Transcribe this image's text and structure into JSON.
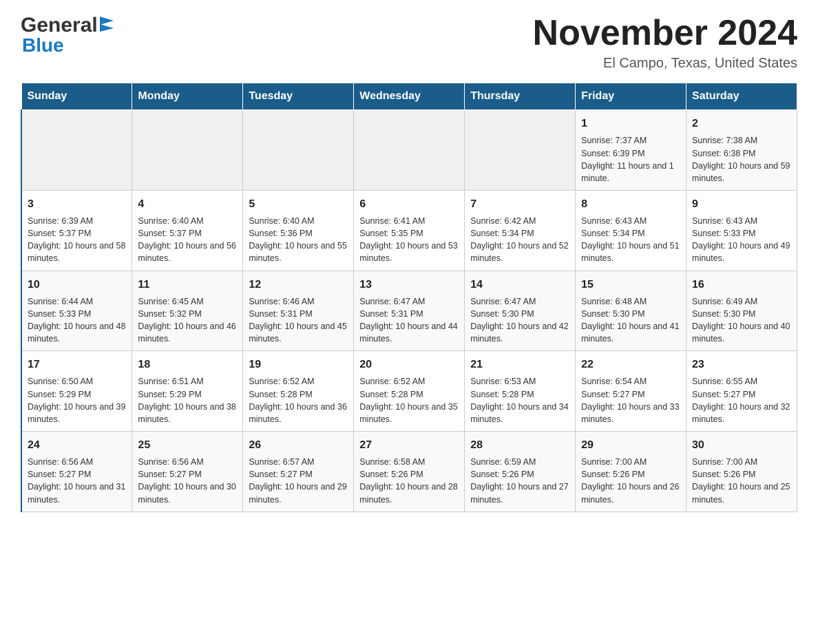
{
  "header": {
    "logo_general": "General",
    "logo_blue": "Blue",
    "month_title": "November 2024",
    "location": "El Campo, Texas, United States"
  },
  "days_of_week": [
    "Sunday",
    "Monday",
    "Tuesday",
    "Wednesday",
    "Thursday",
    "Friday",
    "Saturday"
  ],
  "weeks": [
    [
      {
        "num": "",
        "info": ""
      },
      {
        "num": "",
        "info": ""
      },
      {
        "num": "",
        "info": ""
      },
      {
        "num": "",
        "info": ""
      },
      {
        "num": "",
        "info": ""
      },
      {
        "num": "1",
        "info": "Sunrise: 7:37 AM\nSunset: 6:39 PM\nDaylight: 11 hours and 1 minute."
      },
      {
        "num": "2",
        "info": "Sunrise: 7:38 AM\nSunset: 6:38 PM\nDaylight: 10 hours and 59 minutes."
      }
    ],
    [
      {
        "num": "3",
        "info": "Sunrise: 6:39 AM\nSunset: 5:37 PM\nDaylight: 10 hours and 58 minutes."
      },
      {
        "num": "4",
        "info": "Sunrise: 6:40 AM\nSunset: 5:37 PM\nDaylight: 10 hours and 56 minutes."
      },
      {
        "num": "5",
        "info": "Sunrise: 6:40 AM\nSunset: 5:36 PM\nDaylight: 10 hours and 55 minutes."
      },
      {
        "num": "6",
        "info": "Sunrise: 6:41 AM\nSunset: 5:35 PM\nDaylight: 10 hours and 53 minutes."
      },
      {
        "num": "7",
        "info": "Sunrise: 6:42 AM\nSunset: 5:34 PM\nDaylight: 10 hours and 52 minutes."
      },
      {
        "num": "8",
        "info": "Sunrise: 6:43 AM\nSunset: 5:34 PM\nDaylight: 10 hours and 51 minutes."
      },
      {
        "num": "9",
        "info": "Sunrise: 6:43 AM\nSunset: 5:33 PM\nDaylight: 10 hours and 49 minutes."
      }
    ],
    [
      {
        "num": "10",
        "info": "Sunrise: 6:44 AM\nSunset: 5:33 PM\nDaylight: 10 hours and 48 minutes."
      },
      {
        "num": "11",
        "info": "Sunrise: 6:45 AM\nSunset: 5:32 PM\nDaylight: 10 hours and 46 minutes."
      },
      {
        "num": "12",
        "info": "Sunrise: 6:46 AM\nSunset: 5:31 PM\nDaylight: 10 hours and 45 minutes."
      },
      {
        "num": "13",
        "info": "Sunrise: 6:47 AM\nSunset: 5:31 PM\nDaylight: 10 hours and 44 minutes."
      },
      {
        "num": "14",
        "info": "Sunrise: 6:47 AM\nSunset: 5:30 PM\nDaylight: 10 hours and 42 minutes."
      },
      {
        "num": "15",
        "info": "Sunrise: 6:48 AM\nSunset: 5:30 PM\nDaylight: 10 hours and 41 minutes."
      },
      {
        "num": "16",
        "info": "Sunrise: 6:49 AM\nSunset: 5:30 PM\nDaylight: 10 hours and 40 minutes."
      }
    ],
    [
      {
        "num": "17",
        "info": "Sunrise: 6:50 AM\nSunset: 5:29 PM\nDaylight: 10 hours and 39 minutes."
      },
      {
        "num": "18",
        "info": "Sunrise: 6:51 AM\nSunset: 5:29 PM\nDaylight: 10 hours and 38 minutes."
      },
      {
        "num": "19",
        "info": "Sunrise: 6:52 AM\nSunset: 5:28 PM\nDaylight: 10 hours and 36 minutes."
      },
      {
        "num": "20",
        "info": "Sunrise: 6:52 AM\nSunset: 5:28 PM\nDaylight: 10 hours and 35 minutes."
      },
      {
        "num": "21",
        "info": "Sunrise: 6:53 AM\nSunset: 5:28 PM\nDaylight: 10 hours and 34 minutes."
      },
      {
        "num": "22",
        "info": "Sunrise: 6:54 AM\nSunset: 5:27 PM\nDaylight: 10 hours and 33 minutes."
      },
      {
        "num": "23",
        "info": "Sunrise: 6:55 AM\nSunset: 5:27 PM\nDaylight: 10 hours and 32 minutes."
      }
    ],
    [
      {
        "num": "24",
        "info": "Sunrise: 6:56 AM\nSunset: 5:27 PM\nDaylight: 10 hours and 31 minutes."
      },
      {
        "num": "25",
        "info": "Sunrise: 6:56 AM\nSunset: 5:27 PM\nDaylight: 10 hours and 30 minutes."
      },
      {
        "num": "26",
        "info": "Sunrise: 6:57 AM\nSunset: 5:27 PM\nDaylight: 10 hours and 29 minutes."
      },
      {
        "num": "27",
        "info": "Sunrise: 6:58 AM\nSunset: 5:26 PM\nDaylight: 10 hours and 28 minutes."
      },
      {
        "num": "28",
        "info": "Sunrise: 6:59 AM\nSunset: 5:26 PM\nDaylight: 10 hours and 27 minutes."
      },
      {
        "num": "29",
        "info": "Sunrise: 7:00 AM\nSunset: 5:26 PM\nDaylight: 10 hours and 26 minutes."
      },
      {
        "num": "30",
        "info": "Sunrise: 7:00 AM\nSunset: 5:26 PM\nDaylight: 10 hours and 25 minutes."
      }
    ]
  ]
}
